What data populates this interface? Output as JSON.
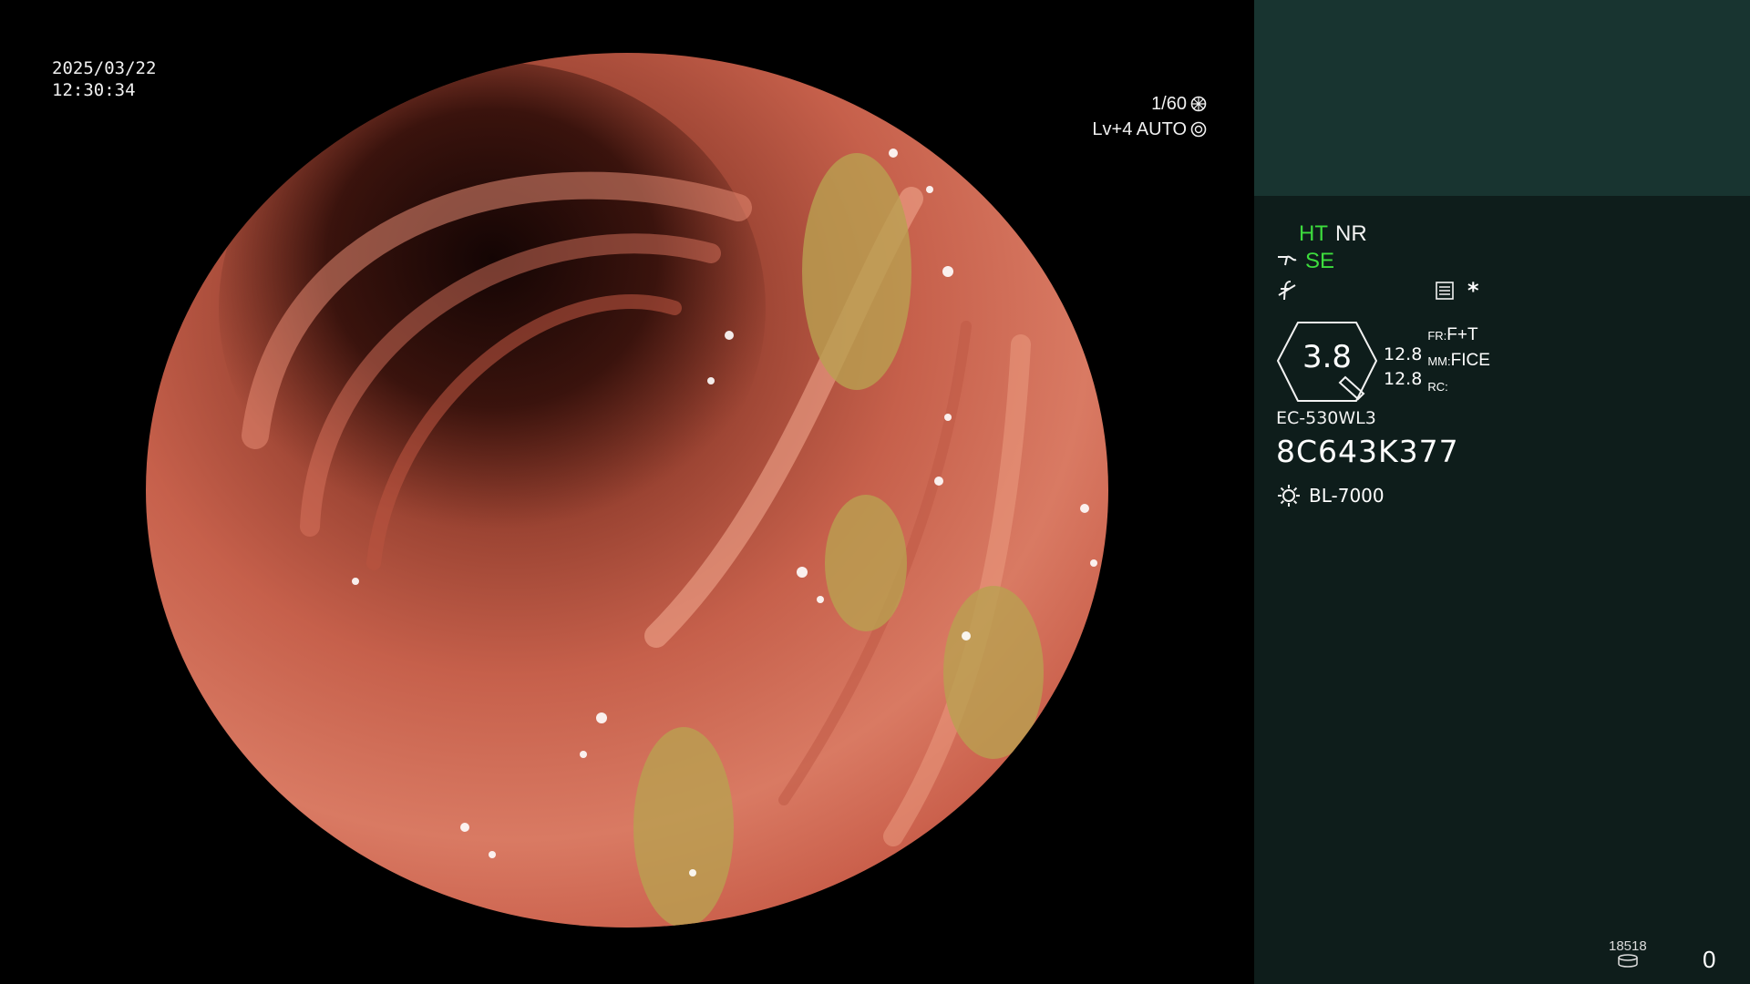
{
  "datetime": {
    "date": "2025/03/22",
    "time": "12:30:34"
  },
  "exposure": {
    "shutter": "1/60",
    "iris": "Lv+4 AUTO",
    "shutter_icon": "shutter-icon",
    "iris_icon": "iris-icon"
  },
  "panel": {
    "mode1": "HT",
    "mode2": "NR",
    "enhance": "SE",
    "scope_sym_icon": "curve-scope-icon",
    "tilde_icon": "struck-f-icon",
    "menu_icon": "menu-list-icon",
    "asterisk": "*",
    "gauge_value": "3.8",
    "gauge_left_top": "12.8",
    "gauge_left_bottom": "12.8",
    "fr_label": "FR:",
    "fr_value": "F+T",
    "mm_label": "MM:",
    "mm_value": "FICE",
    "rc_label": "RC:",
    "scope_model": "EC-530WL3",
    "scope_serial": "8C643K377",
    "light_source": "BL-7000"
  },
  "counter": "18518",
  "counter_icon": "disk-storage-icon",
  "bottom_value": "0",
  "colors": {
    "green": "#3ddc3d",
    "panel_bg": "#0e1d1b",
    "panel_top": "#183430"
  }
}
